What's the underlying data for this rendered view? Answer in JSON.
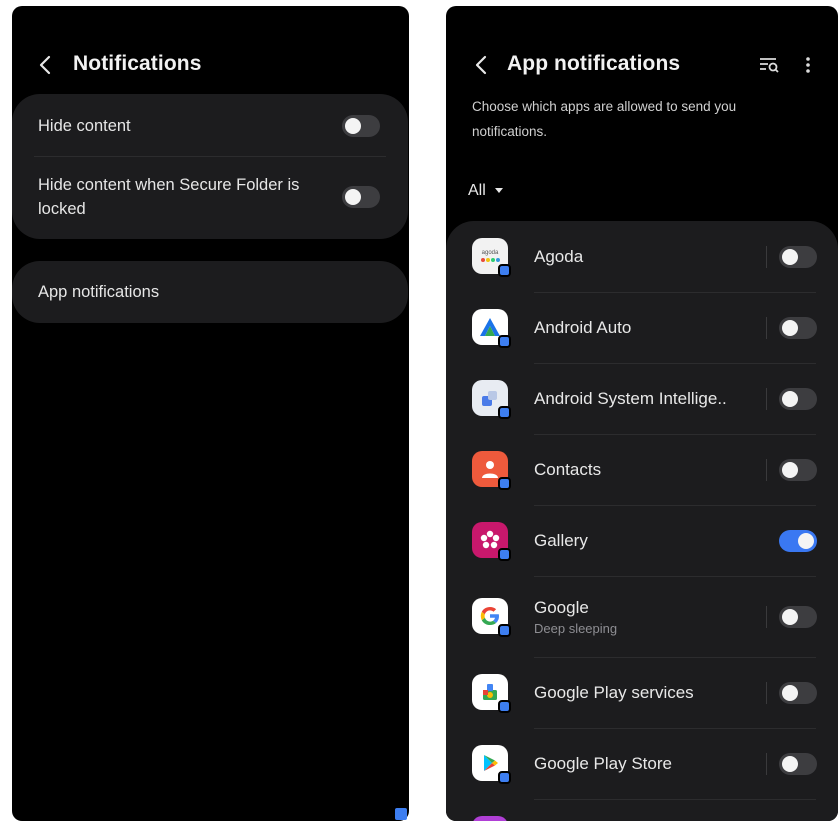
{
  "left": {
    "title": "Notifications",
    "settings": [
      {
        "label": "Hide content",
        "toggle_on": false
      },
      {
        "label": "Hide content when Secure Folder is locked",
        "toggle_on": false
      }
    ],
    "app_notifications_label": "App notifications"
  },
  "right": {
    "title": "App notifications",
    "description": "Choose which apps are allowed to send you notifications.",
    "filter_label": "All",
    "apps": [
      {
        "name": "Agoda",
        "subtitle": "",
        "enabled": false,
        "icon": "agoda-icon",
        "icon_color": "#f2f2f2"
      },
      {
        "name": "Android Auto",
        "subtitle": "",
        "enabled": false,
        "icon": "android-auto-icon",
        "icon_color": "#ffffff"
      },
      {
        "name": "Android System Intellige..",
        "subtitle": "",
        "enabled": false,
        "icon": "android-system-intelligence-icon",
        "icon_color": "#e8ecf2"
      },
      {
        "name": "Contacts",
        "subtitle": "",
        "enabled": false,
        "icon": "contacts-icon",
        "icon_color": "#ee5a3c"
      },
      {
        "name": "Gallery",
        "subtitle": "",
        "enabled": true,
        "icon": "gallery-icon",
        "icon_color": "#c8186c"
      },
      {
        "name": "Google",
        "subtitle": "Deep sleeping",
        "enabled": false,
        "icon": "google-icon",
        "icon_color": "#ffffff"
      },
      {
        "name": "Google Play services",
        "subtitle": "",
        "enabled": false,
        "icon": "google-play-services-icon",
        "icon_color": "#ffffff"
      },
      {
        "name": "Google Play Store",
        "subtitle": "",
        "enabled": false,
        "icon": "google-play-store-icon",
        "icon_color": "#ffffff"
      }
    ]
  },
  "colors": {
    "toggle_on": "#3a78f2",
    "toggle_off": "#3d3d40",
    "card_bg": "#1c1c1e",
    "screen_bg": "#000000"
  }
}
